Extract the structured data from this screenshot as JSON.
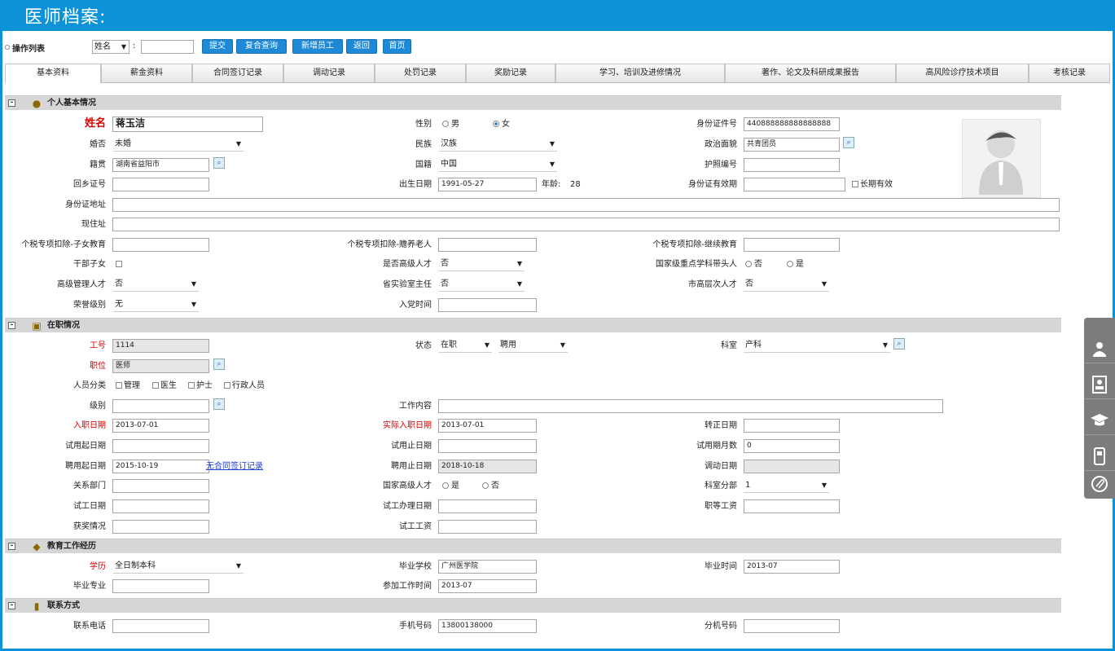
{
  "title": "医师档案:",
  "ops": {
    "label": "操作列表",
    "select": "姓名",
    "colon": ":",
    "query": "",
    "buttons": [
      "提交",
      "复合查询",
      "新增员工",
      "返回",
      "首页"
    ]
  },
  "tabs": [
    "基本资料",
    "薪金资料",
    "合同签订记录",
    "调动记录",
    "处罚记录",
    "奖励记录",
    "学习、培训及进修情况",
    "著作、论文及科研成果报告",
    "高风险诊疗技术项目",
    "考核记录"
  ],
  "sections": {
    "basic": "个人基本情况",
    "job": "在职情况",
    "edu": "教育工作经历",
    "contact": "联系方式"
  },
  "basic": {
    "name_l": "姓名",
    "name_v": "蒋玉洁",
    "gender_l": "性别",
    "gender_m": "男",
    "gender_f": "女",
    "id_l": "身份证件号",
    "id_v": "440888888888888888",
    "married_l": "婚否",
    "married_v": "未婚",
    "ethnic_l": "民族",
    "ethnic_v": "汉族",
    "political_l": "政治面貌",
    "political_v": "共青团员",
    "native_l": "籍贯",
    "native_v": "湖南省益阳市",
    "nation_l": "国籍",
    "nation_v": "中国",
    "passport_l": "护照编号",
    "passport_v": "",
    "return_l": "回乡证号",
    "return_v": "",
    "birth_l": "出生日期",
    "birth_v": "1991-05-27",
    "age_l": "年龄:",
    "age_v": "28",
    "idvalid_l": "身份证有效期",
    "idvalid_v": "",
    "longterm": "长期有效",
    "idaddr_l": "身份证地址",
    "curaddr_l": "现住址",
    "tax_child_l": "个税专项扣除-子女教育",
    "tax_elder_l": "个税专项扣除-赡养老人",
    "tax_edu_l": "个税专项扣除-继续教育",
    "cadre_l": "干部子女",
    "senior_talent_l": "是否高级人才",
    "senior_talent_v": "否",
    "key_subject_l": "国家级重点学科带头人",
    "no": "否",
    "yes": "是",
    "mgmt_l": "高级管理人才",
    "mgmt_v": "否",
    "lab_l": "省实验室主任",
    "lab_v": "否",
    "city_talent_l": "市高层次人才",
    "city_talent_v": "否",
    "honor_l": "荣誉级别",
    "honor_v": "无",
    "party_l": "入党时间",
    "party_v": ""
  },
  "job": {
    "no_l": "工号",
    "no_v": "1114",
    "status_l": "状态",
    "status_v": "在职",
    "status2_v": "聘用",
    "dept_l": "科室",
    "dept_v": "产科",
    "pos_l": "职位",
    "pos_v": "医师",
    "cat_l": "人员分类",
    "cats": [
      "管理",
      "医生",
      "护士",
      "行政人员"
    ],
    "level_l": "级别",
    "work_l": "工作内容",
    "entry_l": "入职日期",
    "entry_v": "2013-07-01",
    "actual_l": "实际入职日期",
    "actual_v": "2013-07-01",
    "regular_l": "转正日期",
    "trial_s_l": "试用起日期",
    "trial_e_l": "试用止日期",
    "trial_m_l": "试用期月数",
    "trial_m_v": "0",
    "hire_s_l": "聘用起日期",
    "hire_s_v": "2015-10-19",
    "contract_link": "无合同签订记录",
    "hire_e_l": "聘用止日期",
    "hire_e_v": "2018-10-18",
    "transfer_l": "调动日期",
    "rel_l": "关系部门",
    "nat_talent_l": "国家高级人才",
    "yes": "是",
    "no": "否",
    "sub_l": "科室分部",
    "sub_v": "1",
    "tw_l": "试工日期",
    "tw_proc_l": "试工办理日期",
    "rank_pay_l": "职等工资",
    "award_l": "获奖情况",
    "tw_pay_l": "试工工资"
  },
  "edu": {
    "degree_l": "学历",
    "degree_v": "全日制本科",
    "school_l": "毕业学校",
    "school_v": "广州医学院",
    "grad_l": "毕业时间",
    "grad_v": "2013-07",
    "major_l": "毕业专业",
    "work_start_l": "参加工作时间",
    "work_start_v": "2013-07"
  },
  "contact": {
    "phone_l": "联系电话",
    "mobile_l": "手机号码",
    "mobile_v": "13800138000",
    "ext_l": "分机号码"
  }
}
